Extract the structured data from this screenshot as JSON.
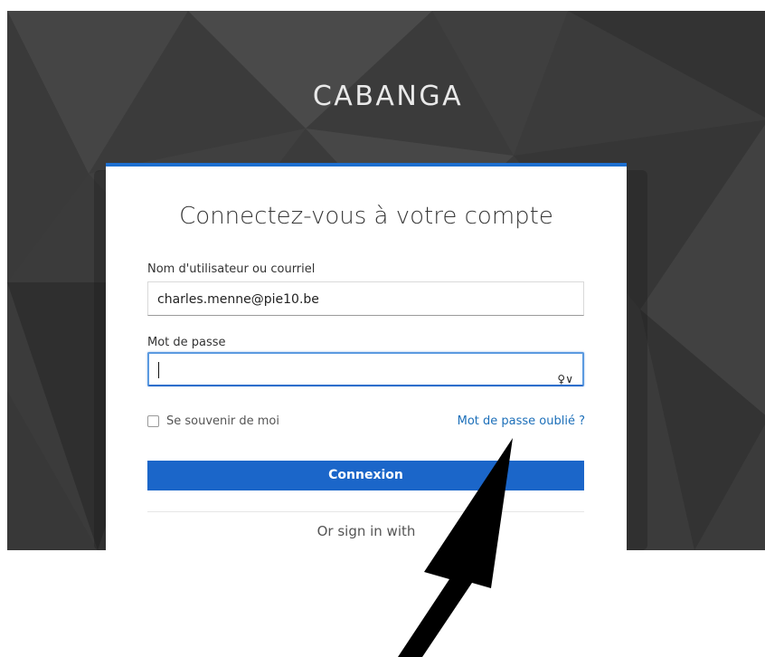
{
  "brand": "CABANGA",
  "login": {
    "title": "Connectez-vous à votre compte",
    "username": {
      "label": "Nom d'utilisateur ou courriel",
      "value": "charles.menne@pie10.be"
    },
    "password": {
      "label": "Mot de passe",
      "value": "",
      "icon": "key-icon",
      "icon_glyph": "♀∨"
    },
    "remember_label": "Se souvenir de moi",
    "forgot_link": "Mot de passe oublié ?",
    "submit_label": "Connexion",
    "alt_signin": "Or sign in with"
  },
  "colors": {
    "accent": "#1b66c9",
    "link": "#1c6fb9",
    "background": "#3b3b3b",
    "annotation_arrow": "#000000"
  }
}
